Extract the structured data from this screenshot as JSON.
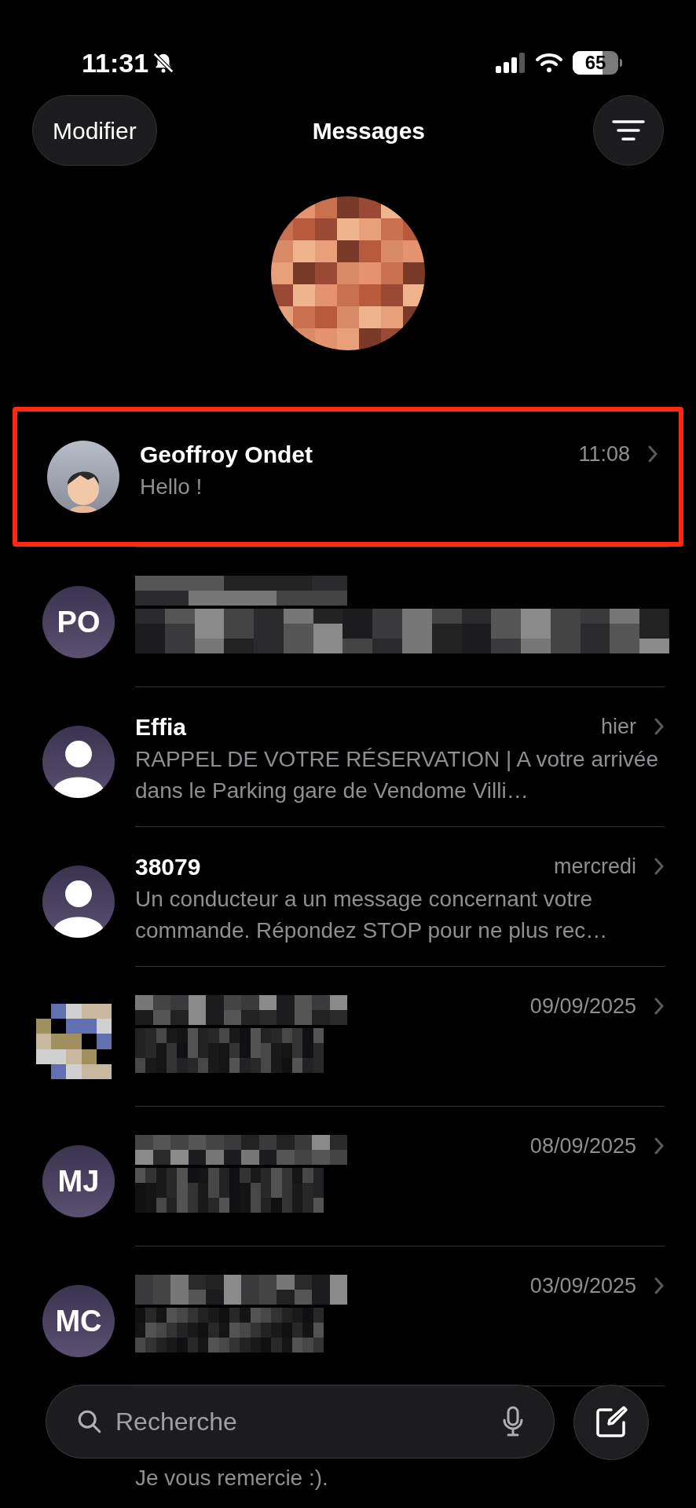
{
  "status_bar": {
    "time": "11:31",
    "battery": "65"
  },
  "header": {
    "edit_button": "Modifier",
    "title": "Messages"
  },
  "pinned": {
    "kind": "pixelated"
  },
  "conversations": [
    {
      "avatar": {
        "kind": "memoji"
      },
      "name": "Geoffroy Ondet",
      "time": "11:08",
      "preview": "Hello !",
      "highlighted": true
    },
    {
      "avatar": {
        "kind": "initials",
        "initials": "PO"
      },
      "highlighted": false
    },
    {
      "avatar": {
        "kind": "person"
      },
      "name": "Effia",
      "time": "hier",
      "preview": "RAPPEL DE VOTRE RÉSERVATION | A votre arrivée dans le Parking gare de Vendome Villi…",
      "highlighted": false
    },
    {
      "avatar": {
        "kind": "person"
      },
      "name": "38079",
      "time": "mercredi",
      "preview": "Un conducteur a un message concernant votre commande. Répondez STOP pour ne plus rec…",
      "highlighted": false
    },
    {
      "avatar": {
        "kind": "pixelated"
      },
      "time": "09/09/2025",
      "highlighted": false
    },
    {
      "avatar": {
        "kind": "initials",
        "initials": "MJ"
      },
      "time": "08/09/2025",
      "highlighted": false
    },
    {
      "avatar": {
        "kind": "initials",
        "initials": "MC"
      },
      "time": "03/09/2025",
      "highlighted": false
    },
    {
      "preview": "Je vous remercie :).",
      "highlighted": false
    }
  ],
  "search": {
    "placeholder": "Recherche"
  }
}
